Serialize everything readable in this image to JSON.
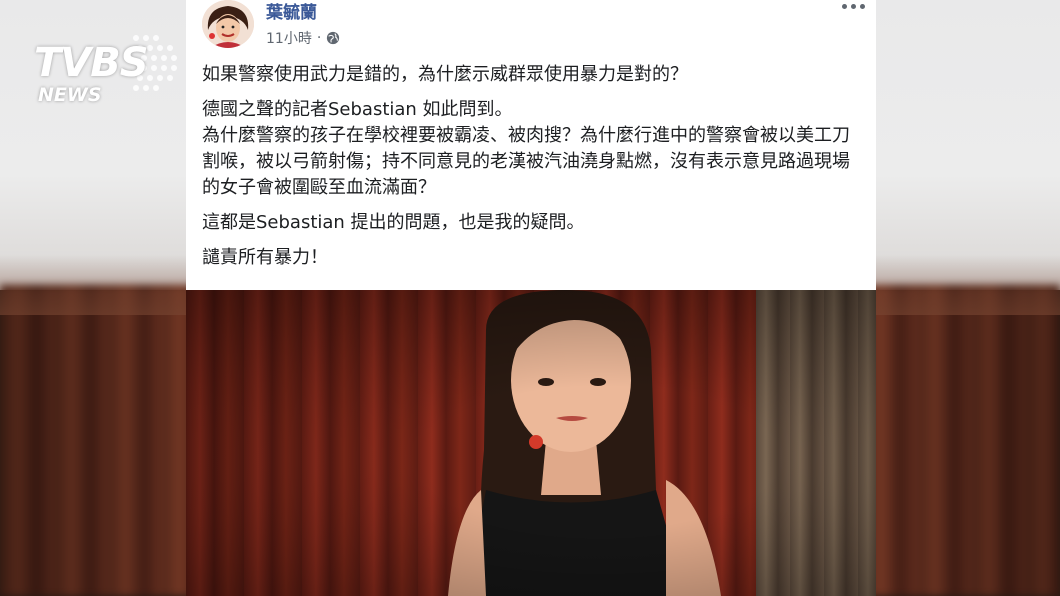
{
  "logo": {
    "brand": "TVBS",
    "sub": "NEWS"
  },
  "post": {
    "author": "葉毓蘭",
    "time": "11小時",
    "separator": "·",
    "paragraphs": [
      "如果警察使用武力是錯的，為什麼示威群眾使用暴力是對的？",
      "德國之聲的記者Sebastian 如此問到。\n為什麼警察的孩子在學校裡要被霸凌、被肉搜？為什麼行進中的警察會被以美工刀割喉，被以弓箭射傷；持不同意見的老漢被汽油澆身點燃，沒有表示意見路過現場的女子會被圍毆至血流滿面？",
      "這都是Sebastian 提出的問題，也是我的疑問。",
      "譴責所有暴力！"
    ]
  },
  "icons": {
    "globe": "globe-icon",
    "more": "more-options-icon",
    "avatar": "profile-avatar"
  },
  "colors": {
    "author": "#3b5998",
    "text": "#1c1e21",
    "meta": "#606770"
  }
}
